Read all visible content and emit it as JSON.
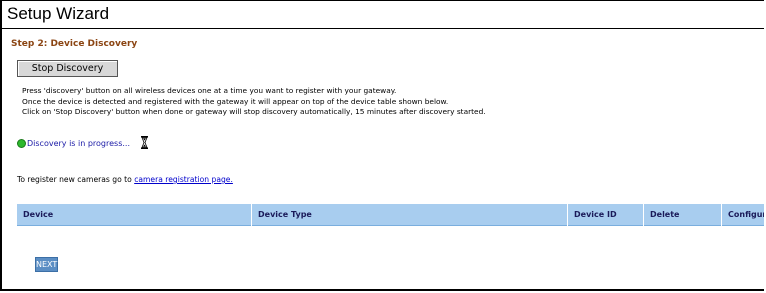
{
  "header": {
    "title": "Setup Wizard"
  },
  "step": {
    "title": "Step 2: Device Discovery"
  },
  "actions": {
    "stop_discovery_label": "Stop Discovery",
    "next_label": "NEXT"
  },
  "instructions": {
    "line1": "Press 'discovery' button on all wireless devices one at a time you want to register with your gateway.",
    "line2": "Once the device is detected and registered with the gateway it will appear on top of the device table shown below.",
    "line3": "Click on 'Stop Discovery' button when done or gateway will stop discovery automatically, 15 minutes after discovery started."
  },
  "status": {
    "text": "Discovery is in progress...",
    "indicator_color": "#2db82d",
    "indicator_icon": "green-dot-icon",
    "busy_icon": "hourglass-icon"
  },
  "register": {
    "prefix": "To register new cameras go to ",
    "link_text": "camera registration page."
  },
  "device_table": {
    "columns": [
      "Device",
      "Device Type",
      "Device ID",
      "Delete",
      "Configure"
    ],
    "rows": []
  },
  "colors": {
    "step_title": "#8b4513",
    "table_header_bg": "#a8cdef",
    "next_button_bg": "#5b8ec4",
    "link": "#0000cc"
  }
}
